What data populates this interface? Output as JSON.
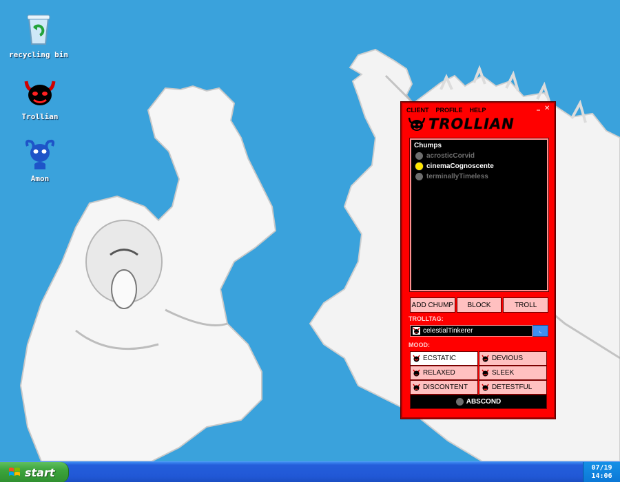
{
  "desktop": {
    "icons": [
      {
        "label": "recycling bin",
        "icon": "recycle-bin-icon"
      },
      {
        "label": "Trollian",
        "icon": "trollian-head-icon"
      },
      {
        "label": "Amon",
        "icon": "amon-head-icon"
      }
    ],
    "background_color": "#3aa2dc"
  },
  "trollian": {
    "menu": [
      "CLIENT",
      "PROFILE",
      "HELP"
    ],
    "logo_text": "TROLLIAN",
    "chumroll": {
      "title": "Chumps",
      "chums": [
        {
          "handle": "acrosticCorvid",
          "status": "offline"
        },
        {
          "handle": "cinemaCognoscente",
          "status": "online"
        },
        {
          "handle": "terminallyTimeless",
          "status": "offline"
        }
      ]
    },
    "buttons": {
      "add_chump": "ADD CHUMP",
      "block": "BLOCK",
      "troll": "TROLL"
    },
    "trolltag": {
      "label": "TROLLTAG:",
      "value": "celestialTinkerer"
    },
    "mood": {
      "label": "MOOD:",
      "options": [
        {
          "label": "ECSTATIC",
          "selected": true
        },
        {
          "label": "DEVIOUS",
          "selected": false
        },
        {
          "label": "RELAXED",
          "selected": false
        },
        {
          "label": "SLEEK",
          "selected": false
        },
        {
          "label": "DISCONTENT",
          "selected": false
        },
        {
          "label": "DETESTFUL",
          "selected": false
        }
      ],
      "abscond": "ABSCOND"
    },
    "colors": {
      "window": "#ff0000",
      "button": "#ffc0c0",
      "online": "#ffe600",
      "offline": "#6e6e6e"
    }
  },
  "taskbar": {
    "start_label": "start",
    "tray_date": "07/19",
    "tray_time": "14:06"
  }
}
